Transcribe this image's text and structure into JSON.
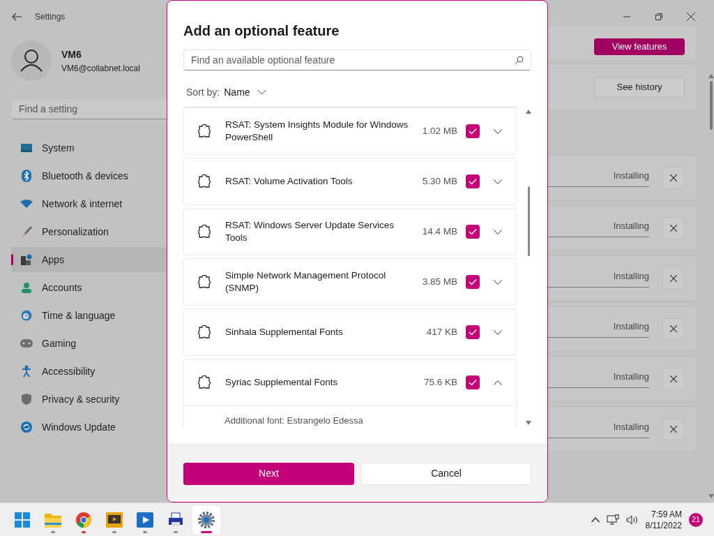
{
  "window": {
    "title": "Settings"
  },
  "account": {
    "name": "VM6",
    "email": "VM6@collabnet.local"
  },
  "search": {
    "placeholder": "Find a setting"
  },
  "nav": [
    {
      "kind": "system",
      "label": "System",
      "selected": false
    },
    {
      "kind": "bluetooth",
      "label": "Bluetooth & devices",
      "selected": false
    },
    {
      "kind": "network",
      "label": "Network & internet",
      "selected": false
    },
    {
      "kind": "brush",
      "label": "Personalization",
      "selected": false
    },
    {
      "kind": "apps",
      "label": "Apps",
      "selected": true
    },
    {
      "kind": "accounts",
      "label": "Accounts",
      "selected": false
    },
    {
      "kind": "time",
      "label": "Time & language",
      "selected": false
    },
    {
      "kind": "gaming",
      "label": "Gaming",
      "selected": false
    },
    {
      "kind": "accessibility",
      "label": "Accessibility",
      "selected": false
    },
    {
      "kind": "privacy",
      "label": "Privacy & security",
      "selected": false
    },
    {
      "kind": "update",
      "label": "Windows Update",
      "selected": false
    }
  ],
  "main": {
    "view_features_button": "View features",
    "see_history_button": "See history",
    "installing": [
      {
        "status": "Installing"
      },
      {
        "status": "Installing"
      },
      {
        "status": "Installing"
      },
      {
        "status": "Installing"
      },
      {
        "status": "Installing"
      },
      {
        "status": "Installing"
      }
    ]
  },
  "dialog": {
    "title": "Add an optional feature",
    "search_placeholder": "Find an available optional feature",
    "sort_label": "Sort by:",
    "sort_value": "Name",
    "features": [
      {
        "name": "RSAT: System Insights Module for Windows PowerShell",
        "size": "1.02 MB",
        "checked": true,
        "expanded": false
      },
      {
        "name": "RSAT: Volume Activation Tools",
        "size": "5.30 MB",
        "checked": true,
        "expanded": false
      },
      {
        "name": "RSAT: Windows Server Update Services Tools",
        "size": "14.4 MB",
        "checked": true,
        "expanded": false
      },
      {
        "name": "Simple Network Management Protocol (SNMP)",
        "size": "3.85 MB",
        "checked": true,
        "expanded": false
      },
      {
        "name": "Sinhala Supplemental Fonts",
        "size": "417 KB",
        "checked": true,
        "expanded": false
      },
      {
        "name": "Syriac Supplemental Fonts",
        "size": "75.6 KB",
        "checked": true,
        "expanded": true,
        "detail": "Additional font: Estrangelo Edessa"
      }
    ],
    "next_button": "Next",
    "cancel_button": "Cancel"
  },
  "taskbar": {
    "apps": [
      {
        "kind": "start",
        "running": false,
        "alert": false,
        "active": false
      },
      {
        "kind": "explorer",
        "running": true,
        "alert": false,
        "active": false
      },
      {
        "kind": "chrome",
        "running": true,
        "alert": true,
        "active": false
      },
      {
        "kind": "media",
        "running": true,
        "alert": false,
        "active": false
      },
      {
        "kind": "player",
        "running": true,
        "alert": false,
        "active": false
      },
      {
        "kind": "fax",
        "running": true,
        "alert": false,
        "active": false
      },
      {
        "kind": "settings",
        "running": true,
        "alert": false,
        "active": true
      }
    ],
    "time": "7:59 AM",
    "date": "8/11/2022",
    "notifications": "21"
  }
}
